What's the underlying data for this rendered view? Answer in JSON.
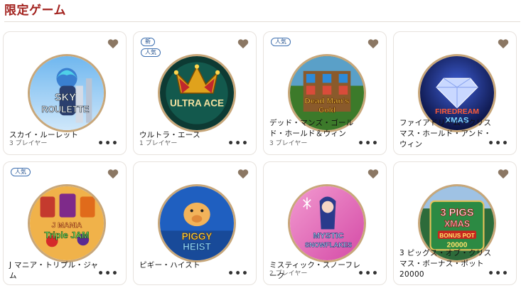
{
  "section": {
    "title": "限定ゲーム"
  },
  "colors": {
    "title": "#a3231f",
    "heart": "#8b7763",
    "badge_border": "#3d6fb0"
  },
  "games": [
    {
      "name": "スカイ・ルーレット",
      "players": "3 プレイヤー",
      "badges": [],
      "art_text": "SKY ROULETTE",
      "more": "•••"
    },
    {
      "name": "ウルトラ・エース",
      "players": "1 プレイヤー",
      "badges": [
        "新",
        "人気"
      ],
      "art_text": "ULTRA ACE",
      "more": "•••"
    },
    {
      "name": "デッド・マンズ・ゴールド・ホールド＆ウィン",
      "players": "3 プレイヤー",
      "badges": [
        "人気"
      ],
      "art_text": "Dead Man's Gold",
      "more": "•••"
    },
    {
      "name": "ファイアドリーム・クリスマス・ホールド・アンド・ウィン",
      "players": "",
      "badges": [],
      "art_text": "FIREDREAM XMAS",
      "more": "•••"
    },
    {
      "name": "J マニア・トリプル・ジャム",
      "players": "",
      "badges": [
        "人気"
      ],
      "art_text": "J MANIA Triple JAM",
      "more": "•••"
    },
    {
      "name": "ピギー・ハイスト",
      "players": "",
      "badges": [],
      "art_text": "PIGGY HEIST",
      "more": "•••"
    },
    {
      "name": "ミスティック・スノーフレーク",
      "players": "2 プレイヤー",
      "badges": [],
      "art_text": "MYSTIC SNOWFLAKES",
      "more": "•••"
    },
    {
      "name": "3 ピッグス・オブ・クリスマス・ボーナス・ポット 20000",
      "players": "",
      "badges": [],
      "art_text": "3 PIGS OF XMAS BONUS POT 20000",
      "more": "•••"
    }
  ]
}
